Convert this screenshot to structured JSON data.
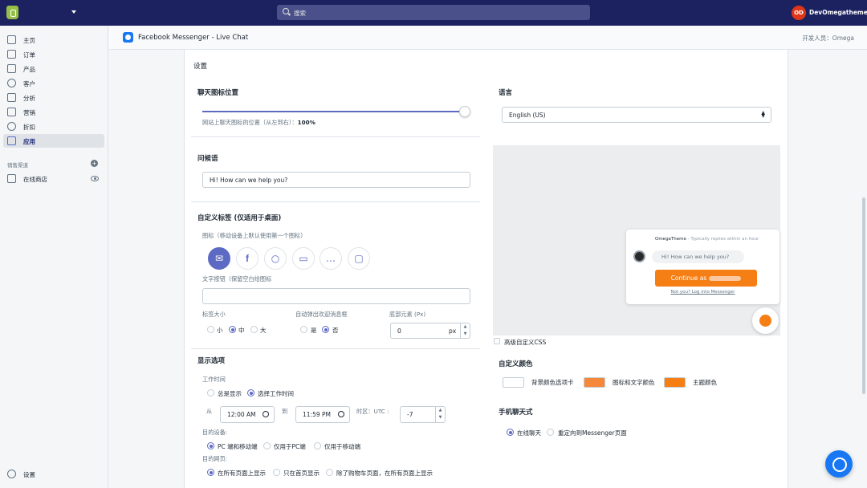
{
  "topbar": {
    "search_placeholder": "搜索",
    "user_initials": "OD",
    "user_name": "DevOmegatheme"
  },
  "sidebar": {
    "items": [
      {
        "label": "主页",
        "icon": "home-icon"
      },
      {
        "label": "订单",
        "icon": "orders-icon"
      },
      {
        "label": "产品",
        "icon": "tag-icon"
      },
      {
        "label": "客户",
        "icon": "person-icon"
      },
      {
        "label": "分析",
        "icon": "bar-chart-icon"
      },
      {
        "label": "营销",
        "icon": "megaphone-icon"
      },
      {
        "label": "折扣",
        "icon": "discount-icon"
      },
      {
        "label": "应用",
        "icon": "apps-icon"
      }
    ],
    "sales_channels_title": "销售渠道",
    "online_store": "在线商店",
    "settings": "设置"
  },
  "app": {
    "title": "Facebook Messenger - Live Chat",
    "developer": "开发人员：Omega"
  },
  "settings": {
    "title": "设置",
    "chat_icon_position": {
      "heading": "聊天图标位置",
      "value_percent": 100,
      "caption": "网站上聊天图标的位置（从左到右）：",
      "value_text": "100%"
    },
    "language": {
      "heading": "语言",
      "selected": "English (US)"
    },
    "greeting": {
      "heading": "问候语",
      "value": "Hi! How can we help you?"
    },
    "custom_tab": {
      "heading": "自定义标签 (仅适用于桌面)",
      "icon_caption": "图标（移动设备上默认使用第一个图标）",
      "icon_options": [
        "messenger-icon",
        "facebook-icon",
        "chat-bubbles-icon",
        "chat-window-icon",
        "speech-dots-icon",
        "message-square-icon"
      ],
      "text_button_label": "文字按钮（保留空白给图标",
      "text_button_value": "",
      "tab_size_label": "标签大小",
      "sizes": [
        "小",
        "中",
        "大"
      ],
      "selected_size": "中",
      "auto_popup_label": "自动弹出欢迎消息框",
      "auto_popup_options": [
        "是",
        "否"
      ],
      "auto_popup_selected": "否",
      "bottom_margin_label": "底部元素 (Px)",
      "bottom_margin_value": "0",
      "bottom_margin_unit": "px"
    },
    "display": {
      "heading": "显示选项",
      "work_time_label": "工作时间",
      "work_time_options": [
        "总是显示",
        "选择工作时间"
      ],
      "work_time_selected": "选择工作时间",
      "from_label": "从",
      "from_time": "12:00 AM",
      "to_label": "到",
      "to_time": "11:59 PM",
      "tz_label": "时区：UTC :",
      "tz_value": "-7",
      "device_label": "目的设备:",
      "device_options": [
        "PC 端和移动端",
        "仅用于PC端",
        "仅用于移动端"
      ],
      "device_selected": "PC 端和移动端",
      "page_label": "目的网页:",
      "page_options": [
        "在所有页面上显示",
        "只在首页显示",
        "除了购物车页面，在所有页面上显示"
      ],
      "page_selected": "在所有页面上显示"
    },
    "preview": {
      "title_brand": "OmegaTheme",
      "title_suffix": " - Typically replies within an hour",
      "greeting": "Hi! How can we help you?",
      "button": "Continue as",
      "link": "Not you? Log into Messenger"
    },
    "advanced_css": "高级自定义CSS",
    "custom_colors": {
      "heading": "自定义颜色",
      "bg_label": "背景颜色选项卡",
      "bg_color": "#ffffff",
      "icon_text_label": "图标和文字颜色",
      "icon_text_color": "#f6883b",
      "theme_label": "主题颜色",
      "theme_color": "#f57e15"
    },
    "mobile_chat": {
      "heading": "手机聊天式",
      "options": [
        "在线聊天",
        "重定向到Messenger页面"
      ],
      "selected": "在线聊天"
    }
  },
  "colors": {
    "topbar": "#1c2260",
    "accent": "#5c6ac4",
    "messenger_blue": "#1877f2",
    "orange": "#f57e15"
  }
}
